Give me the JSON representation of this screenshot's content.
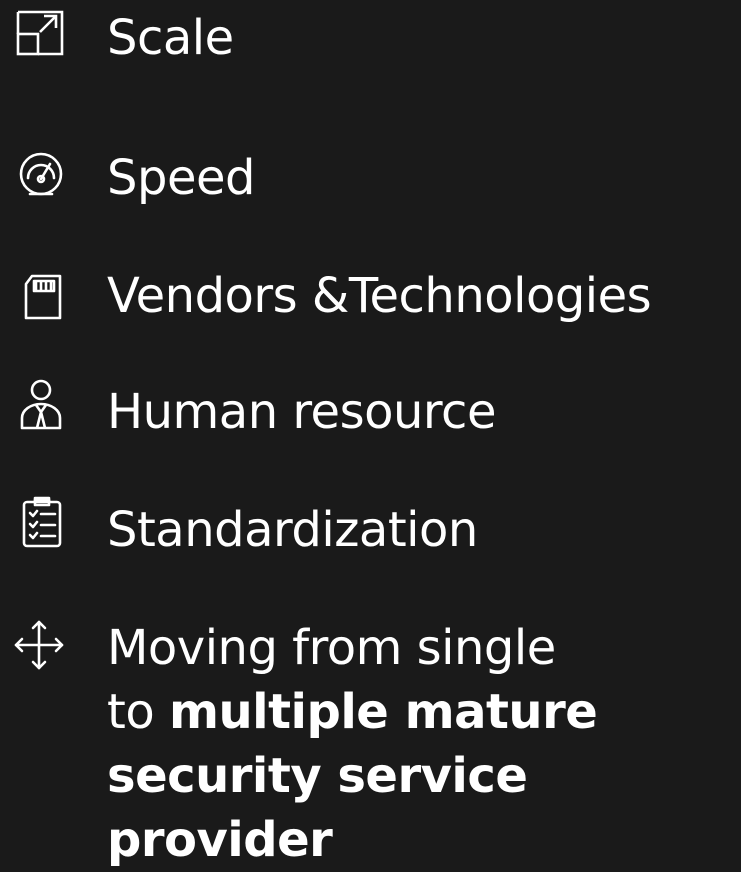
{
  "items": [
    {
      "icon": "scale-icon",
      "label": "Scale"
    },
    {
      "icon": "speedometer-icon",
      "label": "Speed"
    },
    {
      "icon": "sd-card-icon",
      "label": "Vendors &Technologies"
    },
    {
      "icon": "person-icon",
      "label": "Human resource"
    },
    {
      "icon": "clipboard-checklist-icon",
      "label": "Standardization"
    },
    {
      "icon": "move-arrows-icon",
      "label_line1": "Moving from single",
      "label_prefix": "to ",
      "label_bold": "multiple mature security service provider"
    }
  ],
  "colors": {
    "background": "#1a1a1a",
    "text": "#ffffff"
  }
}
